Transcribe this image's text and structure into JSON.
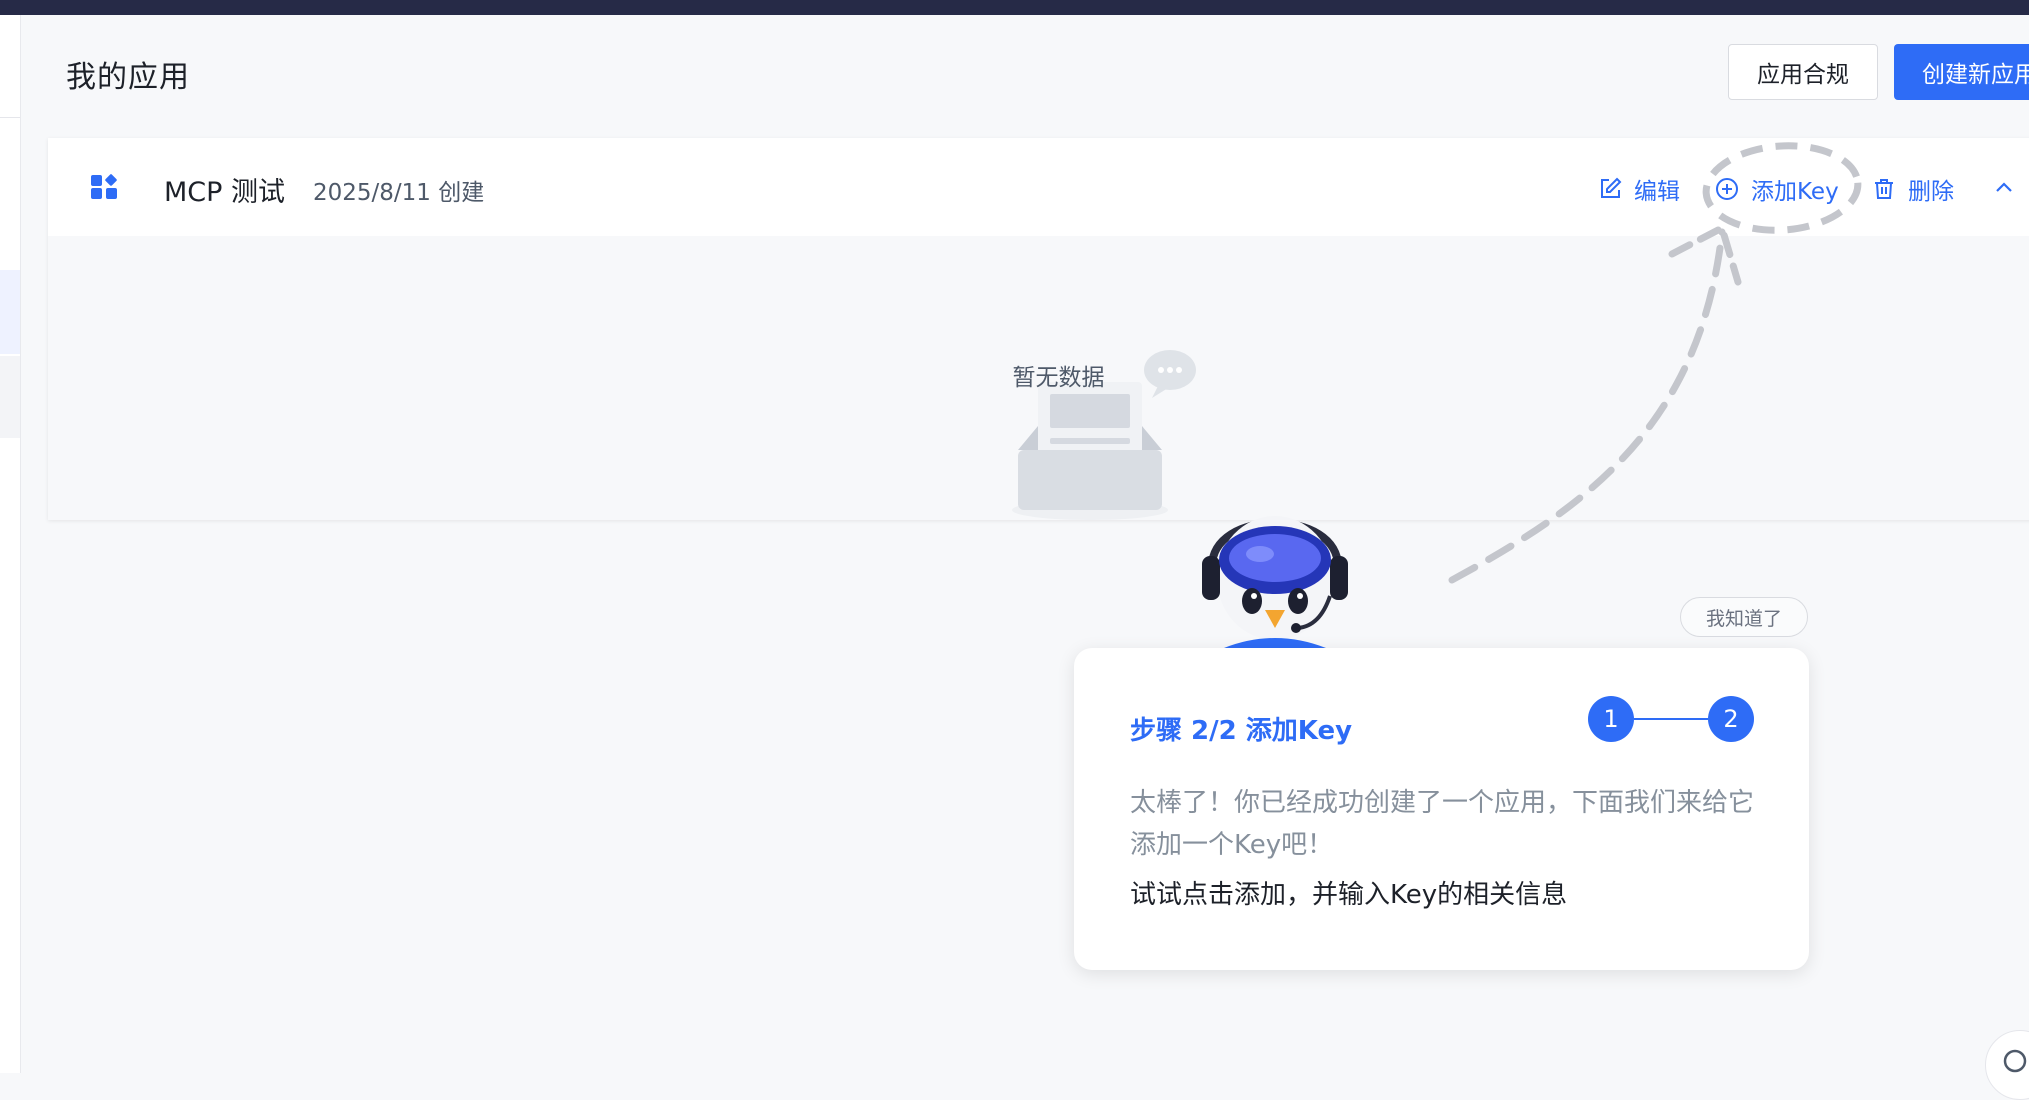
{
  "header": {
    "title": "我的应用",
    "compliance_label": "应用合规",
    "create_label": "创建新应用"
  },
  "app": {
    "name": "MCP 测试",
    "created": "2025/8/11 创建",
    "actions": {
      "edit": "编辑",
      "add_key": "添加Key",
      "delete": "删除"
    },
    "empty_text": "暂无数据"
  },
  "guide": {
    "dismiss_label": "我知道了",
    "step_title": "步骤 2/2 添加Key",
    "steps": [
      "1",
      "2"
    ],
    "description": "太棒了！你已经成功创建了一个应用，下面我们来给它添加一个Key吧！",
    "instruction": "试试点击添加，并输入Key的相关信息"
  },
  "colors": {
    "accent": "#2e6cf6",
    "topbar": "#262a47",
    "background": "#f7f8fa"
  },
  "icons": {
    "app": "apps-grid-icon",
    "edit": "edit-icon",
    "add": "plus-circle-icon",
    "delete": "trash-icon",
    "collapse": "chevron-up-icon",
    "empty": "empty-inbox-icon"
  }
}
